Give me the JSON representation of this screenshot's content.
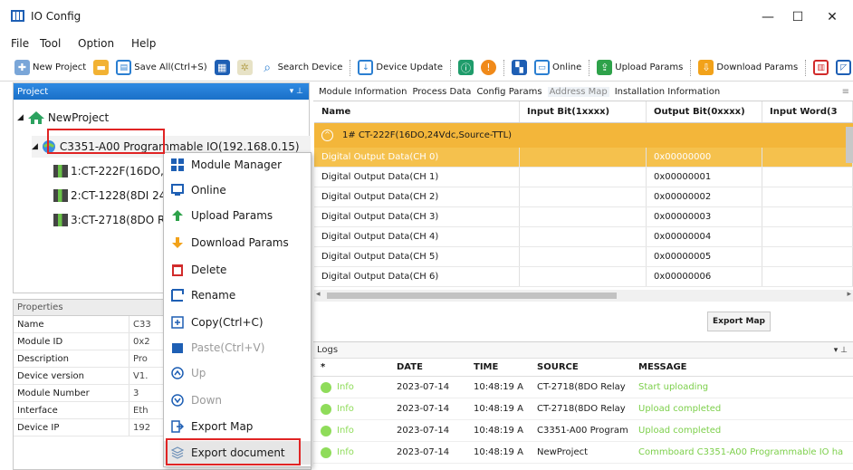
{
  "window": {
    "title": "IO Config",
    "minimize": "—",
    "maximize": "☐",
    "close": "✕"
  },
  "menu": [
    "File",
    "Tool",
    "Option",
    "Help"
  ],
  "toolbar": {
    "new_project": "New Project",
    "save_all": "Save All(Ctrl+S)",
    "search_device": "Search Device",
    "device_update": "Device Update",
    "online": "Online",
    "upload_params": "Upload Params",
    "download_params": "Download Params"
  },
  "project": {
    "header": "Project",
    "pin": "▾ ⊥",
    "root": "NewProject",
    "controller": "C3351-A00 Programmable IO(192.168.0.15)",
    "modules": [
      "1:CT-222F(16DO,24",
      "2:CT-1228(8DI 24V",
      "3:CT-2718(8DO Re"
    ]
  },
  "context_menu": [
    {
      "label": "Module Manager",
      "icon": "module-manager-icon",
      "enabled": true
    },
    {
      "label": "Online",
      "icon": "online-icon",
      "enabled": true
    },
    {
      "label": "Upload Params",
      "icon": "upload-icon",
      "enabled": true
    },
    {
      "label": "Download Params",
      "icon": "download-icon",
      "enabled": true
    },
    {
      "label": "Delete",
      "icon": "delete-icon",
      "enabled": true
    },
    {
      "label": "Rename",
      "icon": "rename-icon",
      "enabled": true
    },
    {
      "label": "Copy(Ctrl+C)",
      "icon": "copy-icon",
      "enabled": true
    },
    {
      "label": "Paste(Ctrl+V)",
      "icon": "paste-icon",
      "enabled": false
    },
    {
      "label": "Up",
      "icon": "up-icon",
      "enabled": false
    },
    {
      "label": "Down",
      "icon": "down-icon",
      "enabled": false
    },
    {
      "label": "Export Map",
      "icon": "export-map-icon",
      "enabled": true
    },
    {
      "label": "Export document",
      "icon": "export-document-icon",
      "enabled": true
    }
  ],
  "properties": {
    "header": "Properties",
    "rows": [
      {
        "name": "Name",
        "value": "C33"
      },
      {
        "name": "Module ID",
        "value": "0x2"
      },
      {
        "name": "Description",
        "value": "Pro"
      },
      {
        "name": "Device version",
        "value": "V1."
      },
      {
        "name": "Module Number",
        "value": "3"
      },
      {
        "name": "Interface",
        "value": "Eth"
      },
      {
        "name": "Device IP",
        "value": "192"
      }
    ]
  },
  "tabs": [
    "Module Information",
    "Process Data",
    "Config Params",
    "Address Map",
    "Installation Information"
  ],
  "active_tab": "Address Map",
  "address_map": {
    "columns": [
      "Name",
      "Input Bit(1xxxx)",
      "Output Bit(0xxxx)",
      "Input Word(3"
    ],
    "group": "1# CT-222F(16DO,24Vdc,Source-TTL)",
    "rows": [
      {
        "name": "Digital Output Data(CH 0)",
        "input": "",
        "output": "0x00000000",
        "word": ""
      },
      {
        "name": "Digital Output Data(CH 1)",
        "input": "",
        "output": "0x00000001",
        "word": ""
      },
      {
        "name": "Digital Output Data(CH 2)",
        "input": "",
        "output": "0x00000002",
        "word": ""
      },
      {
        "name": "Digital Output Data(CH 3)",
        "input": "",
        "output": "0x00000003",
        "word": ""
      },
      {
        "name": "Digital Output Data(CH 4)",
        "input": "",
        "output": "0x00000004",
        "word": ""
      },
      {
        "name": "Digital Output Data(CH 5)",
        "input": "",
        "output": "0x00000005",
        "word": ""
      },
      {
        "name": "Digital Output Data(CH 6)",
        "input": "",
        "output": "0x00000006",
        "word": ""
      }
    ],
    "export_button": "Export Map"
  },
  "logs": {
    "header": "Logs",
    "columns": [
      "*",
      "DATE",
      "TIME",
      "SOURCE",
      "MESSAGE"
    ],
    "rows": [
      {
        "level": "Info",
        "date": "2023-07-14",
        "time": "10:48:19 A",
        "source": "CT-2718(8DO Relay",
        "message": "Start uploading"
      },
      {
        "level": "Info",
        "date": "2023-07-14",
        "time": "10:48:19 A",
        "source": "CT-2718(8DO Relay",
        "message": "Upload completed"
      },
      {
        "level": "Info",
        "date": "2023-07-14",
        "time": "10:48:19 A",
        "source": "C3351-A00 Program",
        "message": "Upload completed"
      },
      {
        "level": "Info",
        "date": "2023-07-14",
        "time": "10:48:19 A",
        "source": "NewProject",
        "message": "Commboard C3351-A00 Programmable IO ha"
      }
    ]
  },
  "colors": {
    "accent": "#1a70c8",
    "selection": "#f3b63a",
    "highlight_box": "#e02424",
    "log_info": "#8fdc5a"
  }
}
